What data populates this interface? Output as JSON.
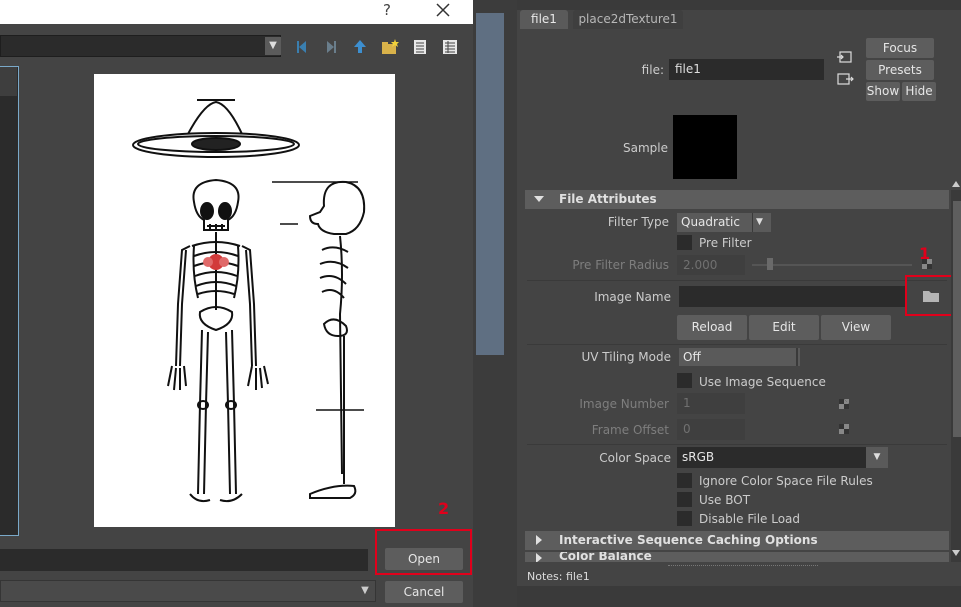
{
  "dialog": {
    "help_glyph": "?",
    "open_label": "Open",
    "cancel_label": "Cancel",
    "annotation_2": "2"
  },
  "editor": {
    "tabs": [
      "file1",
      "place2dTexture1"
    ],
    "file_label": "file:",
    "file_value": "file1",
    "focus_label": "Focus",
    "presets_label": "Presets",
    "show_label": "Show",
    "hide_label": "Hide",
    "sample_label": "Sample",
    "section_file_attributes": "File Attributes",
    "filter_type_label": "Filter Type",
    "filter_type_value": "Quadratic",
    "pre_filter_label": "Pre Filter",
    "pre_filter_radius_label": "Pre Filter Radius",
    "pre_filter_radius_value": "2.000",
    "annotation_1": "1",
    "image_name_label": "Image Name",
    "image_name_value": "",
    "reload_label": "Reload",
    "edit_label": "Edit",
    "view_label": "View",
    "uv_tiling_label": "UV Tiling Mode",
    "uv_tiling_value": "Off",
    "use_image_sequence_label": "Use Image Sequence",
    "image_number_label": "Image Number",
    "image_number_value": "1",
    "frame_offset_label": "Frame Offset",
    "frame_offset_value": "0",
    "color_space_label": "Color Space",
    "color_space_value": "sRGB",
    "ignore_cs_rules_label": "Ignore Color Space File Rules",
    "use_bot_label": "Use BOT",
    "disable_file_load_label": "Disable File Load",
    "section_interactive_caching": "Interactive Sequence Caching Options",
    "section_color_balance_partial": "Color Balance",
    "notes_label": "Notes:",
    "notes_value": "file1"
  },
  "colors": {
    "annotation_red": "#e0001b",
    "panel_bg": "#444444",
    "field_bg": "#2b2b2b"
  }
}
